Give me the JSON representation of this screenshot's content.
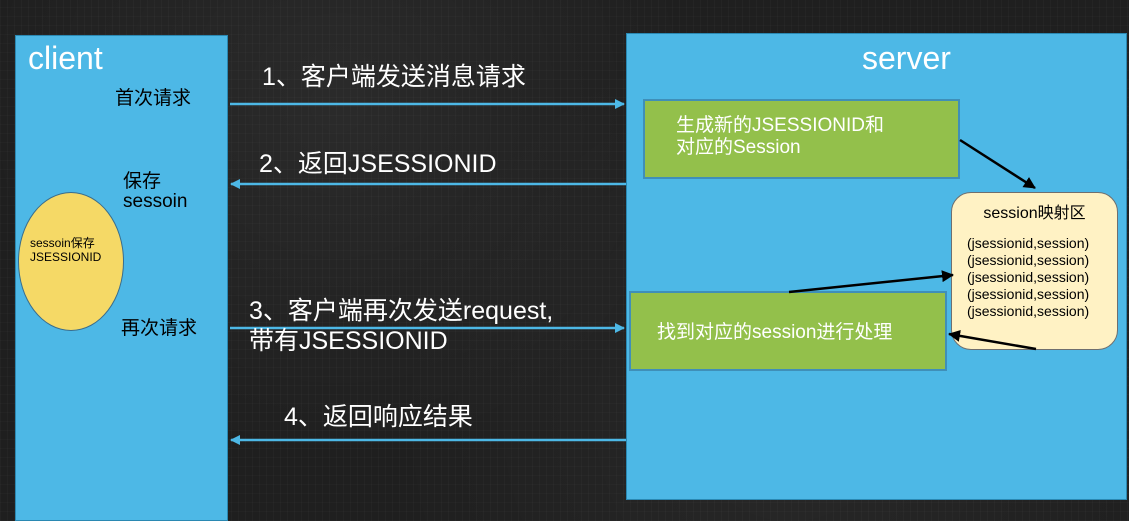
{
  "client": {
    "title": "client",
    "first_request": "首次请求",
    "save_line1": "保存",
    "save_line2": "sessoin",
    "store_line1": "sessoin保存",
    "store_line2": "JSESSIONID",
    "second_request": "再次请求"
  },
  "server": {
    "title": "server",
    "create_line1": "生成新的JSESSIONID和",
    "create_line2": "对应的Session",
    "map_title": "session映射区",
    "map_entries": [
      "(jsessionid,session)",
      "(jsessionid,session)",
      "(jsessionid,session)",
      "(jsessionid,session)",
      "(jsessionid,session)"
    ],
    "find": "找到对应的session进行处理"
  },
  "steps": {
    "step1": "1、客户端发送消息请求",
    "step2": "2、返回JSESSIONID",
    "step3_line1": "3、客户端再次发送request,",
    "step3_line2": "带有JSESSIONID",
    "step4": "4、返回响应结果"
  },
  "colors": {
    "panel": "#4db8e6",
    "green_box": "#93c04b",
    "ellipse": "#f5d966",
    "map_box": "#fff2c4",
    "arrow": "#4db8e6"
  }
}
